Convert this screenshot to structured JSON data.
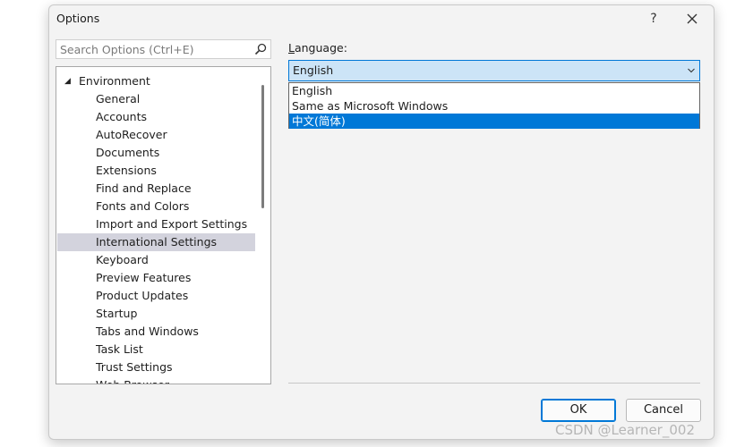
{
  "window": {
    "title": "Options",
    "help_glyph": "?",
    "close_icon": "close-icon"
  },
  "search": {
    "placeholder": "Search Options (Ctrl+E)",
    "icon": "search-icon"
  },
  "tree": {
    "root": {
      "label": "Environment",
      "expanded": true
    },
    "items": [
      {
        "label": "General"
      },
      {
        "label": "Accounts"
      },
      {
        "label": "AutoRecover"
      },
      {
        "label": "Documents"
      },
      {
        "label": "Extensions"
      },
      {
        "label": "Find and Replace"
      },
      {
        "label": "Fonts and Colors"
      },
      {
        "label": "Import and Export Settings"
      },
      {
        "label": "International Settings",
        "selected": true
      },
      {
        "label": "Keyboard"
      },
      {
        "label": "Preview Features"
      },
      {
        "label": "Product Updates"
      },
      {
        "label": "Startup"
      },
      {
        "label": "Tabs and Windows"
      },
      {
        "label": "Task List"
      },
      {
        "label": "Trust Settings"
      },
      {
        "label": "Web Browser"
      }
    ]
  },
  "language": {
    "label_accesskey": "L",
    "label_rest": "anguage:",
    "selected_value": "English",
    "options": [
      {
        "label": "English"
      },
      {
        "label": "Same as Microsoft Windows"
      },
      {
        "label": "中文(简体)",
        "highlighted": true
      }
    ]
  },
  "buttons": {
    "ok": "OK",
    "cancel": "Cancel"
  },
  "watermark": "CSDN @Learner_002",
  "colors": {
    "accent": "#0078d7",
    "combo_bg": "#cce4f7",
    "tree_selected_bg": "#d3d3dd",
    "dialog_bg": "#f3f3f3"
  }
}
